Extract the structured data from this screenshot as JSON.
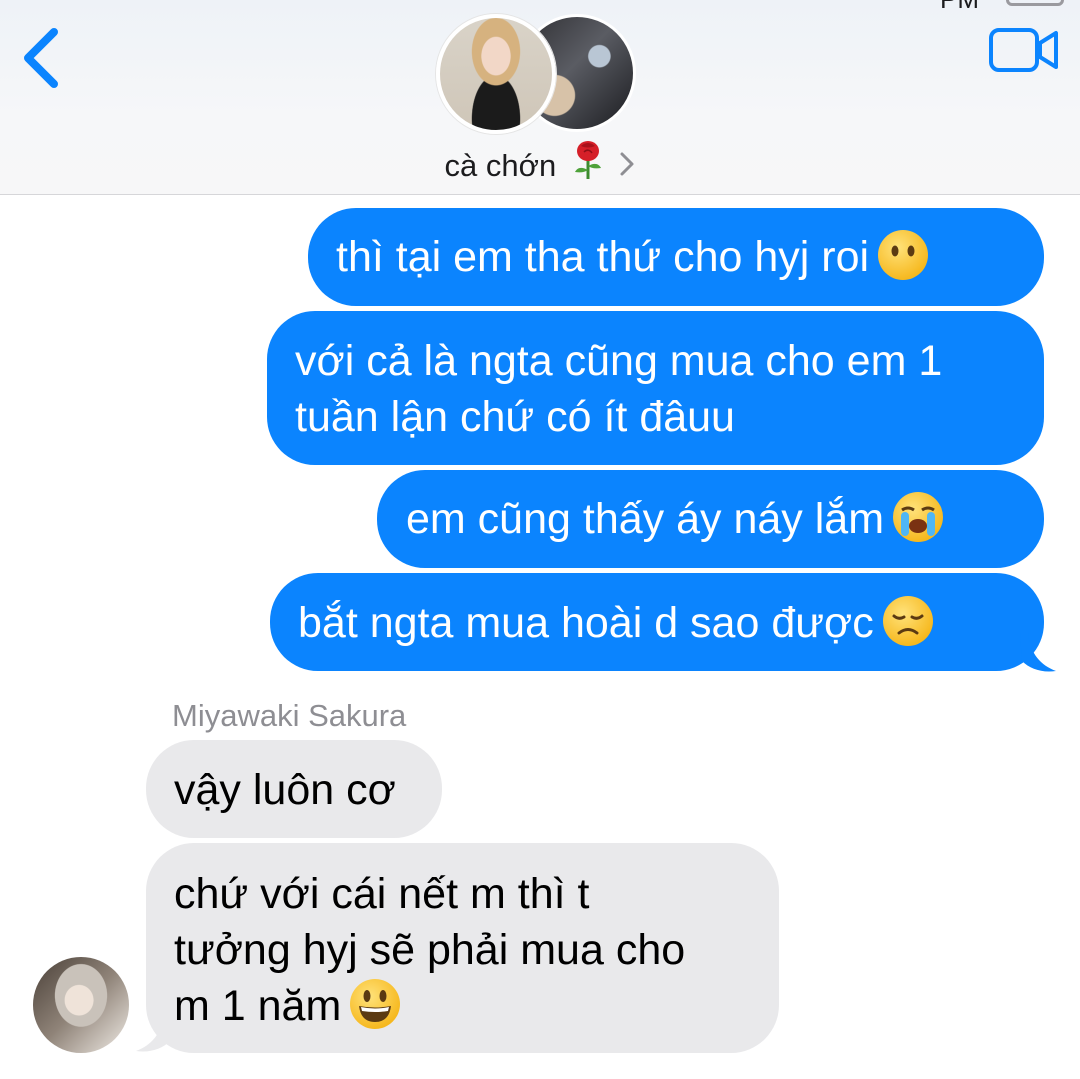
{
  "status_bar": {
    "time_fragment": "PM"
  },
  "header": {
    "back_icon": "chevron-left-icon",
    "video_icon": "video-camera-icon",
    "contact_name": "cà chớn",
    "name_emoji": "rose-emoji",
    "chevron_icon": "chevron-right-icon",
    "accent_color": "#0b84fe"
  },
  "messages": [
    {
      "direction": "outgoing",
      "text": "thì tại em tha thứ cho hyj roi",
      "emoji": "face-without-mouth-emoji"
    },
    {
      "direction": "outgoing",
      "text_line1": "với cả là ngta cũng mua cho em 1",
      "text_line2": "tuần lận chứ có ít đâuu"
    },
    {
      "direction": "outgoing",
      "text": "em cũng thấy áy náy lắm",
      "emoji": "loudly-crying-face-emoji"
    },
    {
      "direction": "outgoing",
      "text": "bắt ngta mua hoài d sao được",
      "emoji": "disappointed-face-emoji"
    },
    {
      "direction": "incoming",
      "sender": "Miyawaki Sakura",
      "text": "vậy luôn cơ"
    },
    {
      "direction": "incoming",
      "text_line1": "chứ với cái nết m thì t",
      "text_line2": "tưởng hyj sẽ phải mua cho",
      "text_line3": "m 1 năm",
      "emoji": "grinning-face-emoji"
    }
  ],
  "colors": {
    "outgoing_bubble": "#0b84fe",
    "incoming_bubble": "#e9e9eb",
    "sender_name": "#8e8e93"
  }
}
